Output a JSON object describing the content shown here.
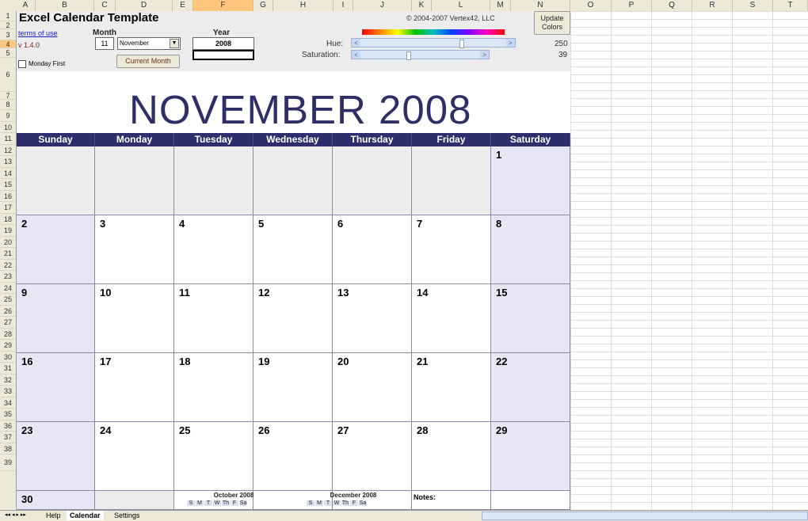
{
  "columns": [
    "A",
    "B",
    "C",
    "D",
    "E",
    "F",
    "G",
    "H",
    "I",
    "J",
    "K",
    "L",
    "M",
    "N",
    "O",
    "P",
    "Q",
    "R",
    "S",
    "T"
  ],
  "rows": [
    "1",
    "2",
    "3",
    "4",
    "5",
    "6",
    "7",
    "8",
    "9",
    "10",
    "11",
    "12",
    "13",
    "14",
    "15",
    "16",
    "17",
    "18",
    "19",
    "20",
    "21",
    "22",
    "23",
    "24",
    "25",
    "26",
    "27",
    "28",
    "29",
    "30",
    "31",
    "32",
    "33",
    "34",
    "35",
    "36",
    "37",
    "38",
    "39"
  ],
  "controls": {
    "title": "Excel Calendar Template",
    "terms_link": "terms of use",
    "version": "v 1.4.0",
    "copyright": "© 2004-2007 Vertex42, LLC",
    "month_label": "Month",
    "month_number": "11",
    "month_select": "November",
    "year_label": "Year",
    "year_value": "2008",
    "current_month_button": "Current Month",
    "monday_first_label": "Monday First",
    "hue_label": "Hue:",
    "saturation_label": "Saturation:",
    "hue_value": "250",
    "saturation_value": "39",
    "update_colors_line1": "Update",
    "update_colors_line2": "Colors",
    "scroll_left": "<",
    "scroll_right": ">"
  },
  "calendar": {
    "month_title": "NOVEMBER  2008",
    "weekdays": [
      "Sunday",
      "Monday",
      "Tuesday",
      "Wednesday",
      "Thursday",
      "Friday",
      "Saturday"
    ],
    "weeks": [
      [
        "",
        "",
        "",
        "",
        "",
        "",
        "1"
      ],
      [
        "2",
        "3",
        "4",
        "5",
        "6",
        "7",
        "8"
      ],
      [
        "9",
        "10",
        "11",
        "12",
        "13",
        "14",
        "15"
      ],
      [
        "16",
        "17",
        "18",
        "19",
        "20",
        "21",
        "22"
      ],
      [
        "23",
        "24",
        "25",
        "26",
        "27",
        "28",
        "29"
      ],
      [
        "30",
        "",
        "",
        "",
        "",
        "",
        ""
      ]
    ],
    "prev_month_title": "October 2008",
    "next_month_title": "December 2008",
    "mini_days": [
      "S",
      "M",
      "T",
      "W",
      "Th",
      "F",
      "Sa"
    ],
    "notes_label": "Notes:"
  },
  "sheet_tabs": {
    "nav": "◂◂ ◂ ▸ ▸▸",
    "help": "Help",
    "calendar": "Calendar",
    "settings": "Settings"
  },
  "colors": {
    "header_bar": "#2e2e6c",
    "weekend_fill": "#e6e6f5",
    "title_text": "#2f2f68"
  }
}
